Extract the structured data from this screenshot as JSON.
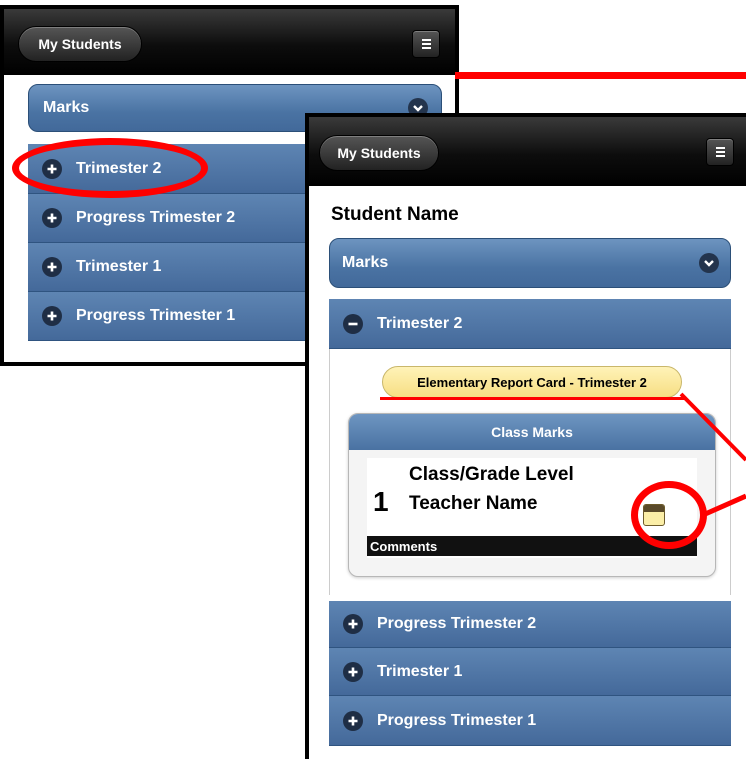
{
  "left_screen": {
    "header": {
      "back_label": "My Students"
    },
    "marks_label": "Marks",
    "rows": [
      {
        "label": "Trimester 2"
      },
      {
        "label": "Progress Trimester 2"
      },
      {
        "label": "Trimester 1"
      },
      {
        "label": "Progress Trimester 1"
      }
    ]
  },
  "right_screen": {
    "header": {
      "back_label": "My Students"
    },
    "student_name": "Student Name",
    "marks_label": "Marks",
    "expanded_row": {
      "label": "Trimester 2"
    },
    "report_card_label": "Elementary Report Card - Trimester 2",
    "class_card": {
      "header": "Class Marks",
      "number": "1",
      "line1": "Class/Grade Level",
      "line2": "Teacher Name",
      "comments_label": "Comments"
    },
    "rows": [
      {
        "label": "Progress Trimester 2"
      },
      {
        "label": "Trimester 1"
      },
      {
        "label": "Progress Trimester 1"
      }
    ]
  },
  "colors": {
    "annotation_red": "#ff0000",
    "row_blue": "#4a73a3",
    "report_pill_yellow": "#f7de83"
  },
  "icons": [
    "menu-icon",
    "chevron-down-icon",
    "plus-circle-icon",
    "minus-circle-icon",
    "note-icon"
  ]
}
